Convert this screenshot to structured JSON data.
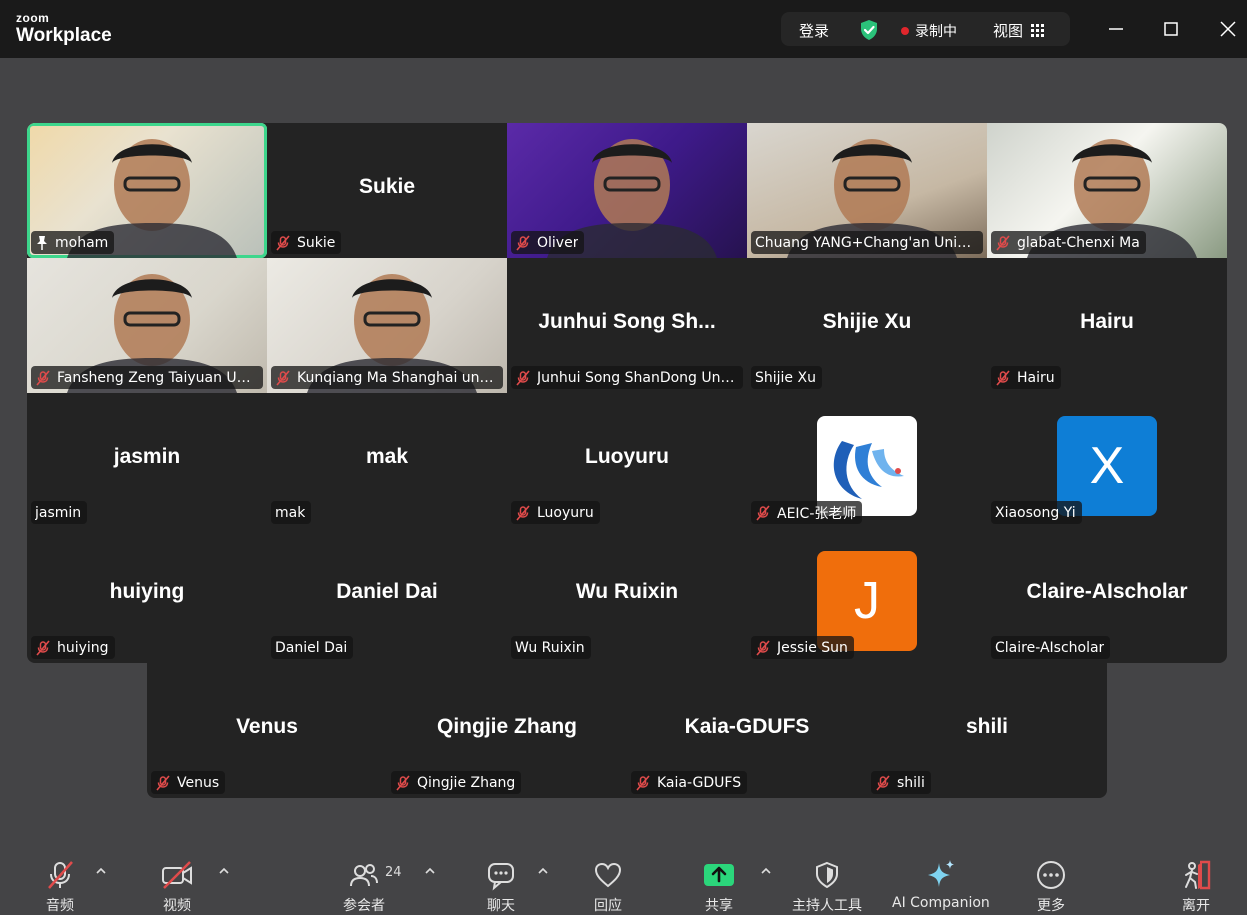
{
  "app": {
    "logo_line1": "zoom",
    "logo_line2": "Workplace"
  },
  "topbar": {
    "login": "登录",
    "recording": "录制中",
    "view": "视图"
  },
  "colors": {
    "active_speaker": "#3dd68c",
    "shield": "#2bc27a",
    "record_dot": "#e0262c",
    "muted_mic": "#e04b4b",
    "share": "#2bd67b"
  },
  "tiles": [
    {
      "name": "moham",
      "label": "moham",
      "muted": false,
      "video": true,
      "active": true
    },
    {
      "name": "Sukie",
      "label": "Sukie",
      "muted": true,
      "video": false
    },
    {
      "name": "Oliver",
      "label": "Oliver",
      "muted": true,
      "video": true
    },
    {
      "name": "Chuang YANG+Chang'an University",
      "label": "Chuang YANG+Chang'an Unive...",
      "muted": false,
      "video": true
    },
    {
      "name": "glabat-Chenxi Ma",
      "label": "glabat-Chenxi Ma",
      "muted": true,
      "video": true
    },
    {
      "name": "Fansheng Zeng",
      "label": "Fansheng Zeng Taiyuan Univ...",
      "muted": true,
      "video": true
    },
    {
      "name": "Kunqiang Ma",
      "label": "Kunqiang Ma Shanghai univ...",
      "muted": true,
      "video": true
    },
    {
      "name": "Junhui Song Sh...",
      "label": "Junhui Song ShanDong Univ...",
      "muted": true,
      "video": false
    },
    {
      "name": "Shijie Xu",
      "label": "Shijie Xu",
      "muted": false,
      "video": false
    },
    {
      "name": "Hairu",
      "label": "Hairu",
      "muted": true,
      "video": false
    },
    {
      "name": "jasmin",
      "label": "jasmin",
      "muted": false,
      "video": false
    },
    {
      "name": "mak",
      "label": "mak",
      "muted": false,
      "video": false
    },
    {
      "name": "Luoyuru",
      "label": "Luoyuru",
      "muted": true,
      "video": false
    },
    {
      "name": "",
      "label": "AEIC-张老师",
      "muted": true,
      "video": false,
      "avatar": "logo"
    },
    {
      "name": "",
      "label": "Xiaosong Yi",
      "muted": false,
      "video": false,
      "avatar": "X",
      "avatar_color": "#0e7ed6"
    },
    {
      "name": "huiying",
      "label": "huiying",
      "muted": true,
      "video": false
    },
    {
      "name": "Daniel Dai",
      "label": "Daniel Dai",
      "muted": false,
      "video": false
    },
    {
      "name": "Wu Ruixin",
      "label": "Wu Ruixin",
      "muted": false,
      "video": false
    },
    {
      "name": "",
      "label": "Jessie Sun",
      "muted": true,
      "video": false,
      "avatar": "J",
      "avatar_color": "#f06e0c"
    },
    {
      "name": "Claire-AIscholar",
      "label": "Claire-AIscholar",
      "muted": false,
      "video": false
    },
    {
      "name": "Venus",
      "label": "Venus",
      "muted": true,
      "video": false
    },
    {
      "name": "Qingjie Zhang",
      "label": "Qingjie Zhang",
      "muted": true,
      "video": false
    },
    {
      "name": "Kaia-GDUFS",
      "label": "Kaia-GDUFS",
      "muted": true,
      "video": false
    },
    {
      "name": "shili",
      "label": "shili",
      "muted": true,
      "video": false
    }
  ],
  "toolbar": {
    "audio": "音频",
    "video": "视频",
    "participants": "参会者",
    "participants_count": "24",
    "chat": "聊天",
    "react": "回应",
    "share": "共享",
    "host_tools": "主持人工具",
    "ai_companion": "AI Companion",
    "more": "更多",
    "leave": "离开"
  }
}
